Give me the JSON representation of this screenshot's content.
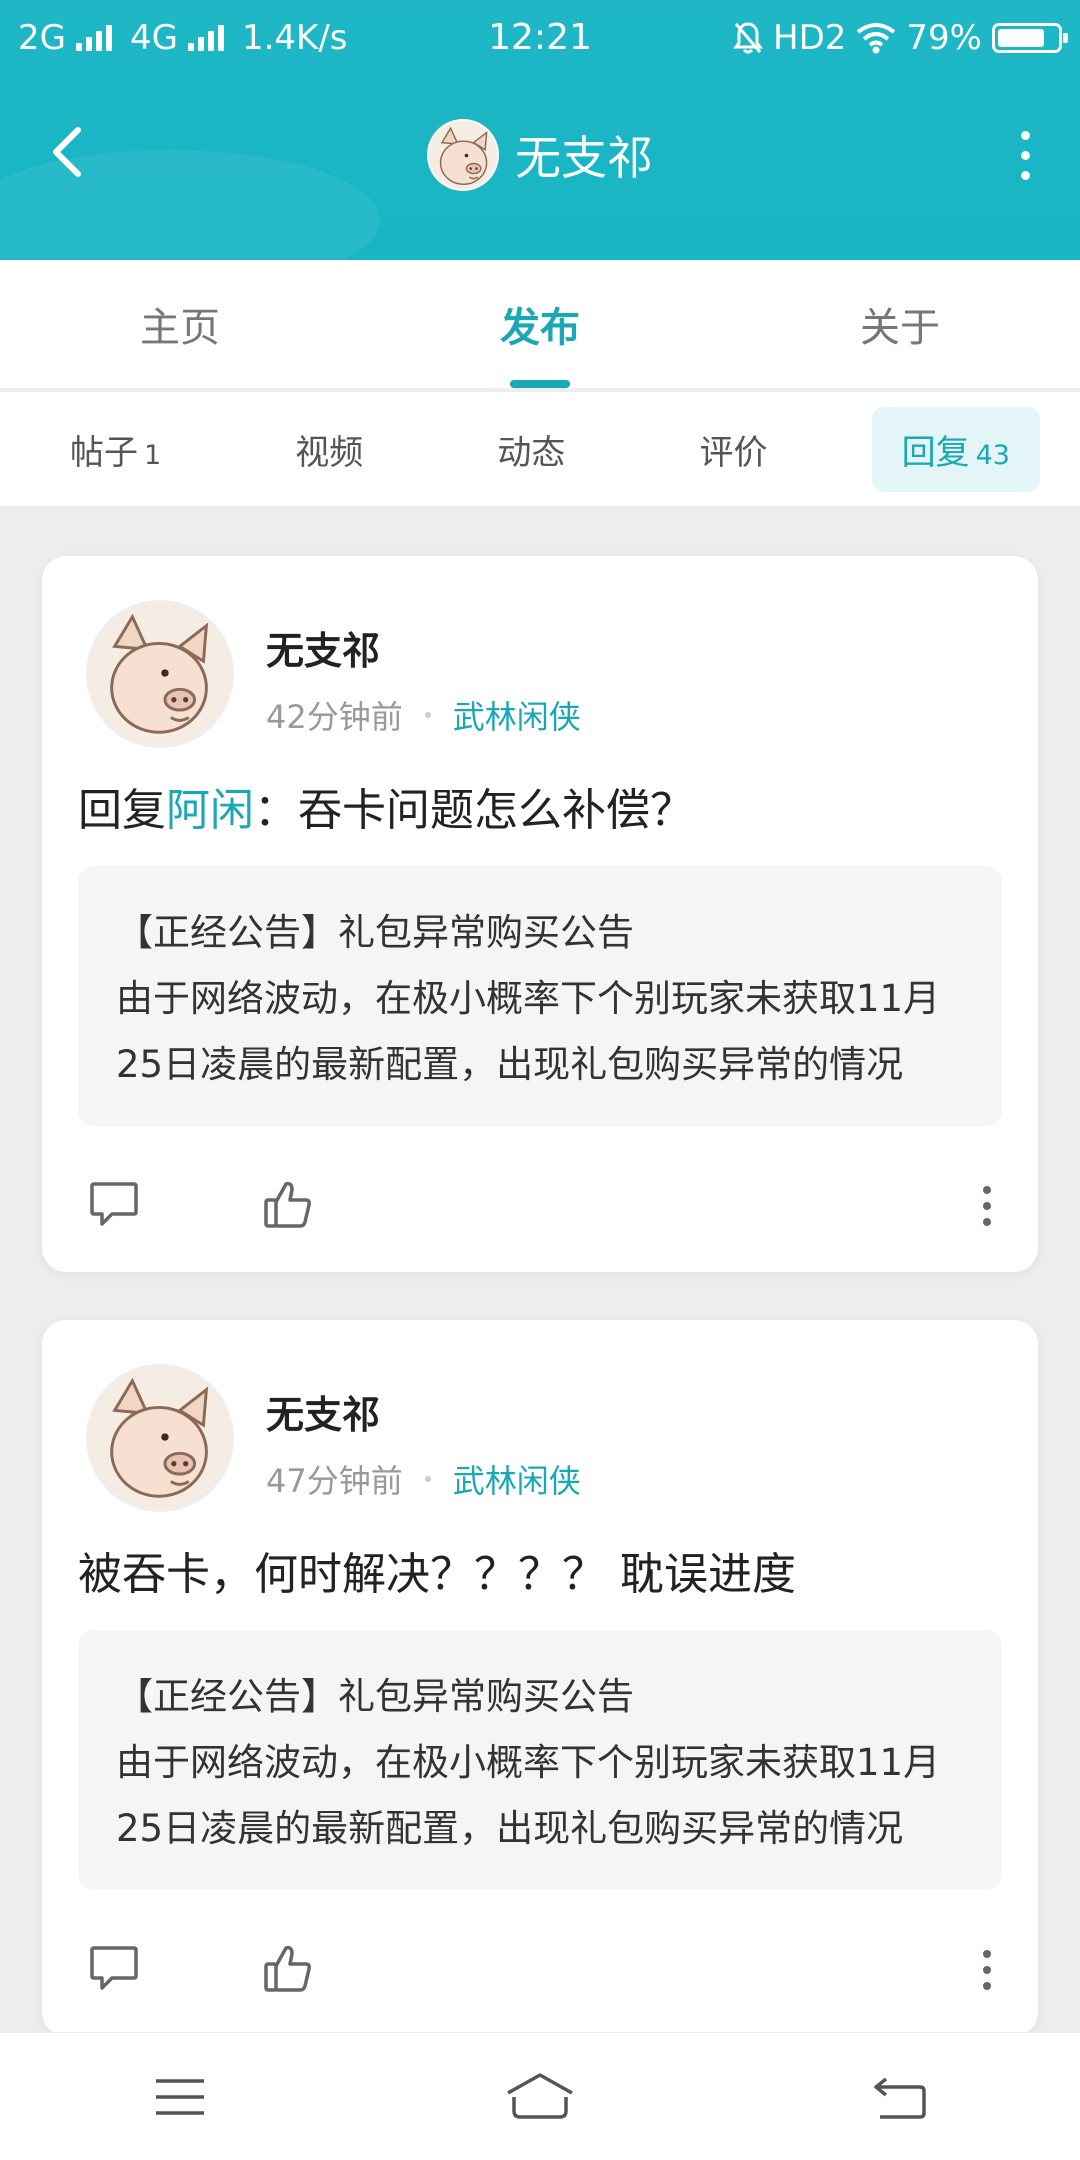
{
  "status_bar": {
    "network_1": "2G",
    "network_2": "4G",
    "speed": "1.4K/s",
    "time": "12:21",
    "hd": "HD2",
    "battery": "79%",
    "battery_level": 0.79
  },
  "header": {
    "title": "无支祁"
  },
  "main_tabs": [
    {
      "label": "主页",
      "active": false
    },
    {
      "label": "发布",
      "active": true
    },
    {
      "label": "关于",
      "active": false
    }
  ],
  "sub_tabs": [
    {
      "label": "帖子",
      "count": "1"
    },
    {
      "label": "视频",
      "count": ""
    },
    {
      "label": "动态",
      "count": ""
    },
    {
      "label": "评价",
      "count": ""
    },
    {
      "label": "回复",
      "count": "43",
      "active": true
    }
  ],
  "posts": [
    {
      "author": "无支祁",
      "time": "42分钟前",
      "level": "武林闲侠",
      "prefix": "回复",
      "mention": "阿闲",
      "text": "：吞卡问题怎么补偿？",
      "quote_title": "【正经公告】礼包异常购买公告",
      "quote_body": "由于网络波动，在极小概率下个别玩家未获取11月25日凌晨的最新配置，出现礼包购买异常的情况"
    },
    {
      "author": "无支祁",
      "time": "47分钟前",
      "level": "武林闲侠",
      "text": "被吞卡，何时解决？？？？ 耽误进度",
      "quote_title": "【正经公告】礼包异常购买公告",
      "quote_body": "由于网络波动，在极小概率下个别玩家未获取11月25日凌晨的最新配置，出现礼包购买异常的情况"
    }
  ]
}
